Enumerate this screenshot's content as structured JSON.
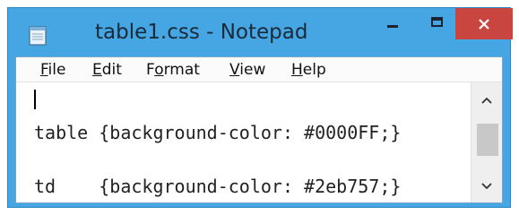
{
  "window": {
    "title": "table1.css - Notepad",
    "icons": {
      "app": "notepad-icon",
      "minimize": "minimize-icon",
      "maximize": "maximize-icon",
      "close": "close-icon"
    },
    "colors": {
      "titlebar": "#45a6e3",
      "close_button": "#c9453f"
    }
  },
  "menu": {
    "items": [
      {
        "key": "F",
        "rest": "ile"
      },
      {
        "key": "E",
        "rest": "dit"
      },
      {
        "pre": "F",
        "key": "o",
        "rest": "rmat"
      },
      {
        "key": "V",
        "rest": "iew"
      },
      {
        "key": "H",
        "rest": "elp"
      }
    ]
  },
  "editor": {
    "lines": [
      "table {background-color: #0000FF;}",
      "td    {background-color: #2eb757;}"
    ]
  },
  "scrollbar": {
    "icons": {
      "up": "scroll-up-arrow-icon",
      "down": "scroll-down-arrow-icon"
    }
  }
}
